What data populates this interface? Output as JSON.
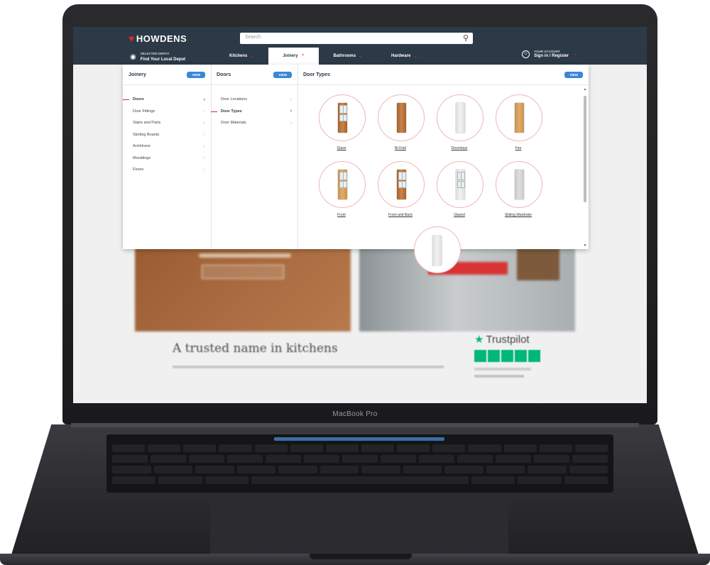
{
  "device": {
    "label": "MacBook Pro"
  },
  "header": {
    "logo": "HOWDENS",
    "search_placeholder": "Search",
    "depot": {
      "small": "SELECTED DEPOT",
      "main": "Find Your Local Depot"
    },
    "nav": [
      {
        "label": "Kitchens",
        "active": false
      },
      {
        "label": "Joinery",
        "active": true
      },
      {
        "label": "Bathrooms",
        "active": false
      },
      {
        "label": "Hardware",
        "active": false
      }
    ],
    "account": {
      "small": "YOUR ACCOUNT",
      "main": "Sign in / Register"
    }
  },
  "mega_menu": {
    "col1": {
      "title": "Joinery",
      "view_label": "VIEW",
      "items": [
        "Doors",
        "Door Fittings",
        "Stairs and Parts",
        "Skirting Boards",
        "Architrave",
        "Mouldings",
        "Floors"
      ],
      "active_index": 0
    },
    "col2": {
      "title": "Doors",
      "view_label": "VIEW",
      "items": [
        "Door Locations",
        "Door Types",
        "Door Materials"
      ],
      "active_index": 1
    },
    "col3": {
      "title": "Door Types",
      "view_label": "VIEW",
      "tiles": [
        {
          "label": "Glaze",
          "style": "wood",
          "panes": true
        },
        {
          "label": "Bi-Fold",
          "style": "wood",
          "panes": false
        },
        {
          "label": "Doorstops",
          "style": "white",
          "panes": false
        },
        {
          "label": "Fire",
          "style": "oak",
          "panes": false
        },
        {
          "label": "Front",
          "style": "oak",
          "panes": true
        },
        {
          "label": "Front and Back",
          "style": "wood",
          "panes": true
        },
        {
          "label": "Glazed",
          "style": "white",
          "panes": true
        },
        {
          "label": "Sliding Wardrobe",
          "style": "grey",
          "panes": false
        }
      ]
    }
  },
  "colors": {
    "header_bg": "#2b3a46",
    "accent_red": "#e2252b",
    "view_button": "#3b87d6",
    "trustpilot_green": "#00b67a"
  },
  "background_page": {
    "heading": "A trusted name in kitchens",
    "trustpilot": "Trustpilot"
  }
}
